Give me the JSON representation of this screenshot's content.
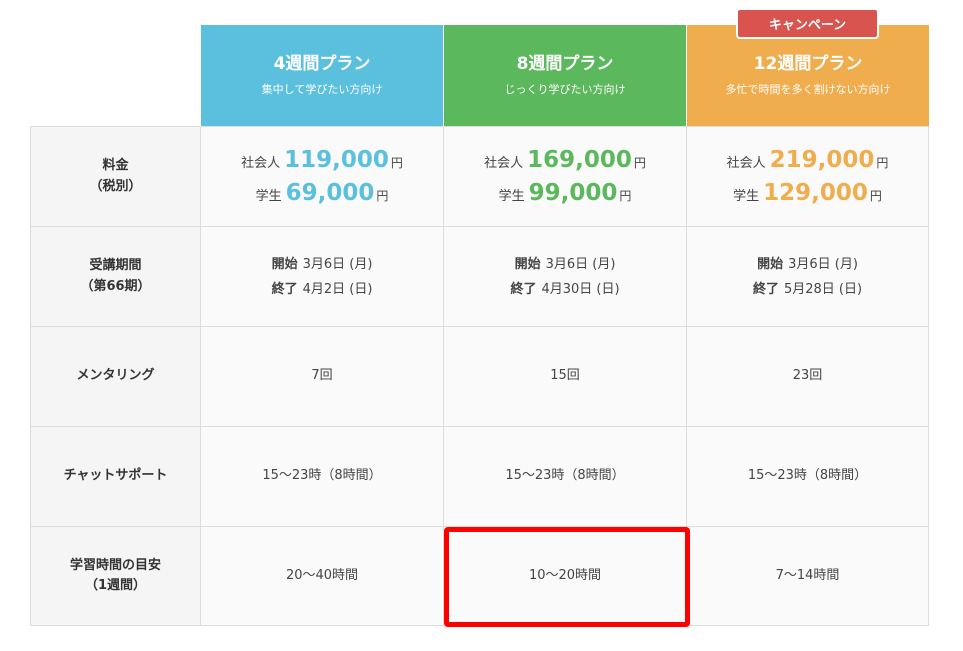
{
  "badge": "キャンペーン",
  "plans": [
    {
      "title": "4週間プラン",
      "subtitle": "集中して学びたい方向け"
    },
    {
      "title": "8週間プラン",
      "subtitle": "じっくり学びたい方向け"
    },
    {
      "title": "12週間プラン",
      "subtitle": "多忙で時間を多く割けない方向け"
    }
  ],
  "rows": {
    "price": {
      "label_line1": "料金",
      "label_line2": "（税別）"
    },
    "period": {
      "label_line1": "受講期間",
      "label_line2": "（第66期）"
    },
    "mentoring": {
      "label": "メンタリング"
    },
    "chat": {
      "label": "チャットサポート"
    },
    "study": {
      "label_line1": "学習時間の目安",
      "label_line2": "（1週間）"
    }
  },
  "prices": {
    "professional_label": "社会人",
    "student_label": "学生",
    "yen": "円",
    "professional": [
      "119,000",
      "169,000",
      "219,000"
    ],
    "student": [
      "69,000",
      "99,000",
      "129,000"
    ]
  },
  "period": {
    "start_label": "開始",
    "end_label": "終了",
    "start": [
      "3月6日 (月)",
      "3月6日 (月)",
      "3月6日 (月)"
    ],
    "end": [
      "4月2日 (日)",
      "4月30日 (日)",
      "5月28日 (日)"
    ]
  },
  "mentoring": [
    "7回",
    "15回",
    "23回"
  ],
  "chat": [
    "15～23時（8時間）",
    "15～23時（8時間）",
    "15～23時（8時間）"
  ],
  "study": [
    "20～40時間",
    "10～20時間",
    "7～14時間"
  ],
  "colors": {
    "plan4": "#5bc0de",
    "plan8": "#5cb85c",
    "plan12": "#f0ad4e",
    "badge": "#d9534f",
    "highlight": "#ff0000"
  }
}
